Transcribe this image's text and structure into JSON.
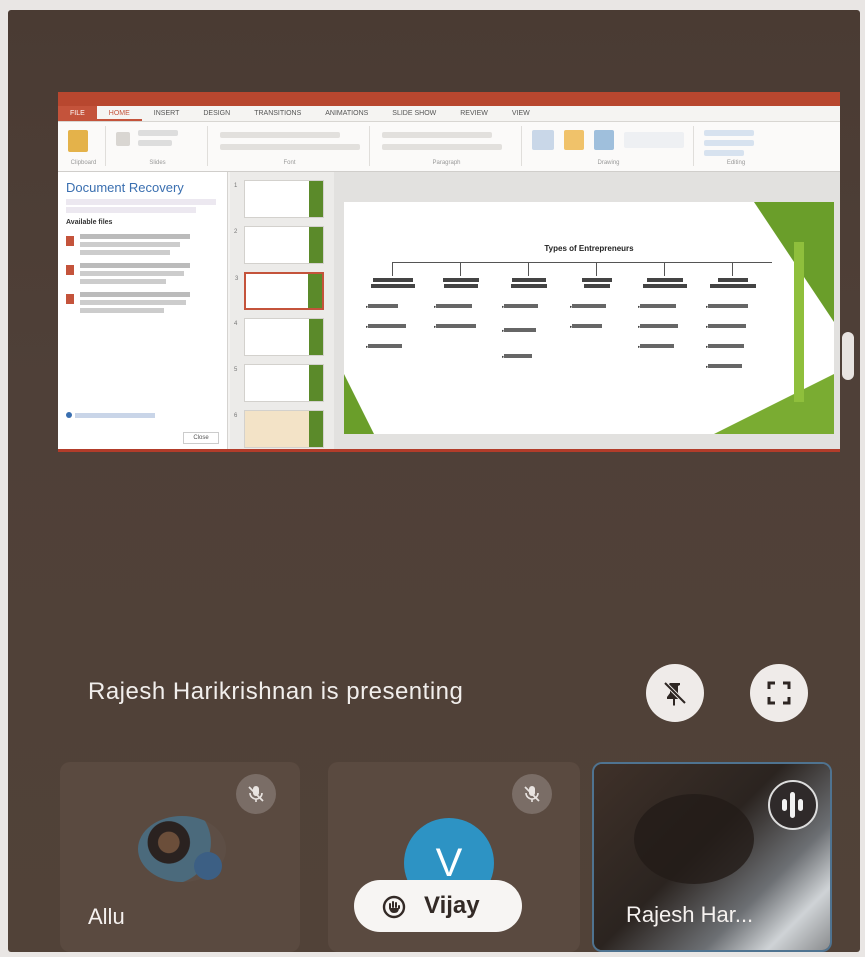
{
  "presentation": {
    "status_text": "Rajesh Harikrishnan is presenting",
    "buttons": {
      "unpin_icon": "pin-off-icon",
      "fullscreen_icon": "fullscreen-icon"
    }
  },
  "shared_screen": {
    "app": "PowerPoint",
    "ribbon_tabs": [
      "FILE",
      "HOME",
      "INSERT",
      "DESIGN",
      "TRANSITIONS",
      "ANIMATIONS",
      "SLIDE SHOW",
      "REVIEW",
      "VIEW"
    ],
    "ribbon_groups": [
      "Clipboard",
      "Slides",
      "Font",
      "Paragraph",
      "Drawing",
      "Editing"
    ],
    "document_recovery": {
      "title": "Document Recovery",
      "available_files_label": "Available files",
      "close_label": "Close"
    },
    "slide": {
      "title": "Types of Entrepreneurs"
    }
  },
  "participants": [
    {
      "name": "Allu",
      "muted": true
    },
    {
      "name": "Vijay",
      "initial": "V",
      "muted": true,
      "hand_raised": true
    },
    {
      "name": "Rajesh Har...",
      "speaking": true
    }
  ],
  "colors": {
    "background": "#4f4038",
    "tile": "#5a4a40",
    "avatar_v": "#2d93c4",
    "active_border": "#4f7390",
    "ppt_accent": "#c4533b",
    "slide_green": "#6a9e2a"
  }
}
